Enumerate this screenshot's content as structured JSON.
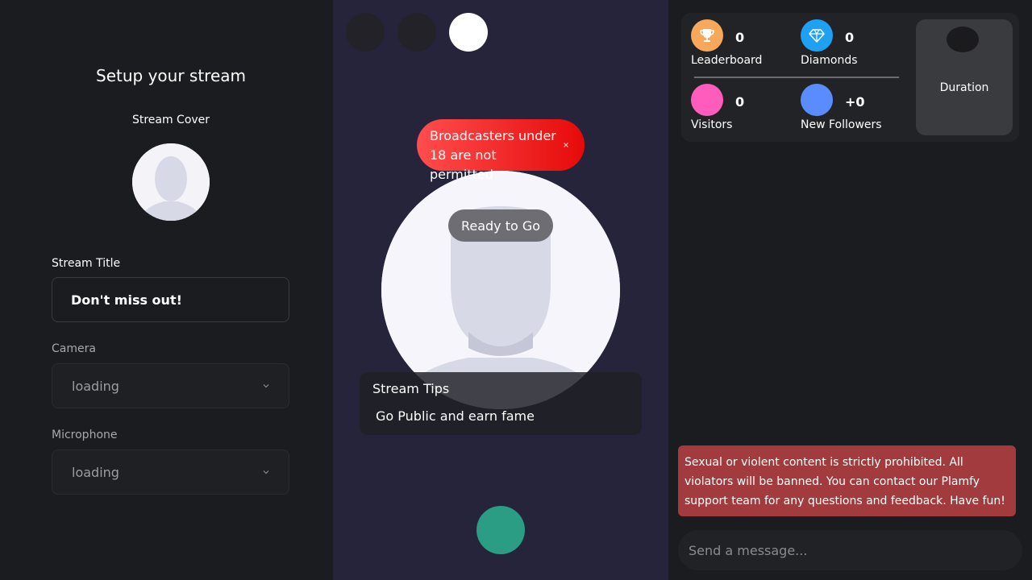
{
  "setup": {
    "title": "Setup your stream",
    "cover_label": "Stream Cover",
    "title_label": "Stream Title",
    "title_value": "Don't miss out!",
    "camera_label": "Camera",
    "camera_value": "loading",
    "microphone_label": "Microphone",
    "microphone_value": "loading"
  },
  "preview": {
    "warning": "Broadcasters under 18 are not permitted",
    "close_glyph": "×",
    "ready": "Ready to Go",
    "tips_title": "Stream Tips",
    "tips_body": "Go Public and earn fame"
  },
  "stats": {
    "leaderboard": {
      "value": "0",
      "label": "Leaderboard",
      "icon": "trophy-icon",
      "color": "#f7a85a"
    },
    "diamonds": {
      "value": "0",
      "label": "Diamonds",
      "icon": "diamond-icon",
      "color": "#1ea1f2"
    },
    "visitors": {
      "value": "0",
      "label": "Visitors",
      "color": "#ff5cbe"
    },
    "followers": {
      "value": "+0",
      "label": "New Followers",
      "color": "#5b8cff"
    },
    "duration_label": "Duration"
  },
  "chat": {
    "rules": "Sexual or violent content is strictly prohibited. All violators will be banned. You can contact our Plamfy support team for any questions and feedback. Have fun!",
    "placeholder": "Send a message..."
  },
  "colors": {
    "left_bg": "#1b1c1f",
    "preview_bg": "#26243a",
    "go_live": "#2a9d84",
    "warning_red": "#ff4d4d",
    "rules_red": "#a23b3e"
  }
}
